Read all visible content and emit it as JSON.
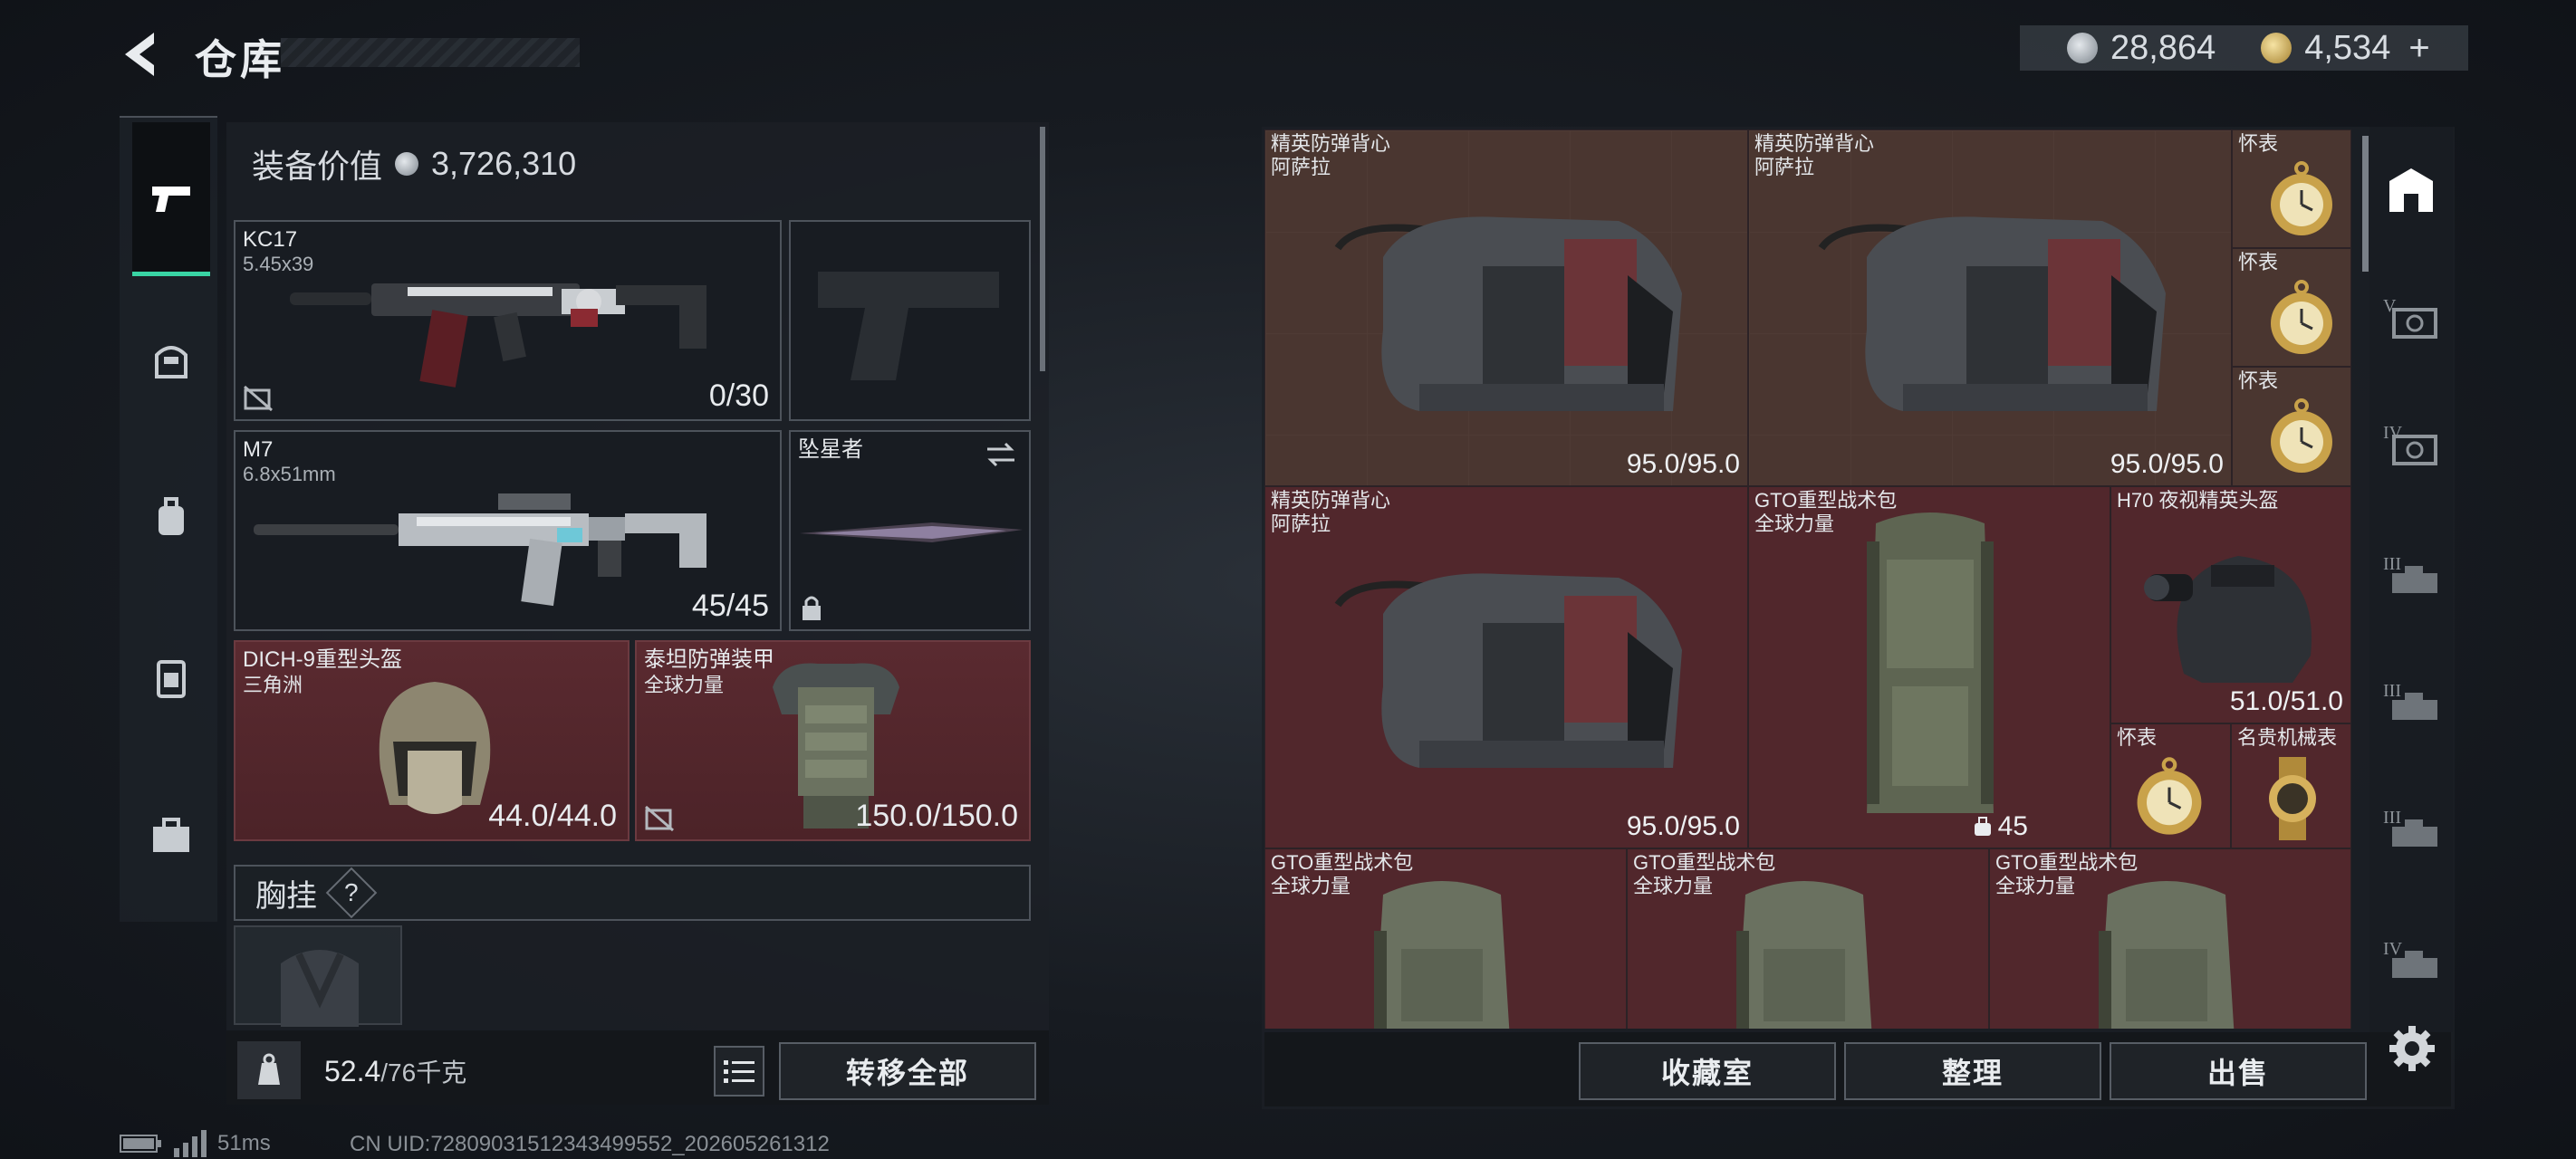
{
  "header": {
    "title": "仓库",
    "currency_silver": "28,864",
    "currency_gold": "4,534",
    "plus": "+"
  },
  "left_nav": [
    {
      "icon": "pistol-icon"
    },
    {
      "icon": "helmet-icon"
    },
    {
      "icon": "backpack-icon"
    },
    {
      "icon": "vest-icon"
    },
    {
      "icon": "briefcase-icon"
    }
  ],
  "equipment": {
    "value_label": "装备价值",
    "value": "3,726,310",
    "primary_weapon": {
      "name": "KC17",
      "caliber": "5.45x39",
      "ammo": "0/30"
    },
    "secondary_weapon": {
      "name": "M7",
      "caliber": "6.8x51mm",
      "ammo": "45/45"
    },
    "melee": {
      "name": "坠星者"
    },
    "helmet": {
      "name": "DICH-9重型头盔",
      "faction": "三角洲",
      "durability": "44.0/44.0"
    },
    "armor": {
      "name": "泰坦防弹装甲",
      "faction": "全球力量",
      "durability": "150.0/150.0"
    },
    "chest_rig": {
      "label": "胸挂",
      "help": "?"
    },
    "weight": {
      "current": "52.4",
      "capacity": "/76千克"
    },
    "transfer_all": "转移全部"
  },
  "storage": {
    "items": [
      {
        "name": "精英防弹背心",
        "sub": "阿萨拉",
        "value": "95.0/95.0"
      },
      {
        "name": "精英防弹背心",
        "sub": "阿萨拉",
        "value": "95.0/95.0"
      },
      {
        "name": "怀表"
      },
      {
        "name": "怀表"
      },
      {
        "name": "怀表"
      },
      {
        "name": "精英防弹背心",
        "sub": "阿萨拉",
        "value": "95.0/95.0"
      },
      {
        "name": "GTO重型战术包",
        "sub": "全球力量",
        "value": "45"
      },
      {
        "name": "H70 夜视精英头盔",
        "value": "51.0/51.0"
      },
      {
        "name": "怀表"
      },
      {
        "name": "名贵机械表"
      },
      {
        "name": "GTO重型战术包",
        "sub": "全球力量"
      },
      {
        "name": "GTO重型战术包",
        "sub": "全球力量"
      },
      {
        "name": "GTO重型战术包",
        "sub": "全球力量"
      }
    ],
    "actions": [
      "收藏室",
      "整理",
      "出售"
    ]
  },
  "right_nav": [
    {
      "label": "",
      "icon": "storage-home-icon"
    },
    {
      "label": "V",
      "icon": "tier-v-safe-icon"
    },
    {
      "label": "IV",
      "icon": "tier-iv-safe-icon"
    },
    {
      "label": "III",
      "icon": "tier-iii-case-icon"
    },
    {
      "label": "III",
      "icon": "tier-iii-case-icon"
    },
    {
      "label": "III",
      "icon": "tier-iii-case-icon"
    },
    {
      "label": "IV",
      "icon": "tier-iv-case-icon"
    }
  ],
  "footer": {
    "ping": "51ms",
    "uid": "CN UID:7280903151234349955​2_202605261312"
  },
  "colors": {
    "accent": "#39d4a4",
    "item_red": "#51272c",
    "item_brown": "#4a3630"
  }
}
